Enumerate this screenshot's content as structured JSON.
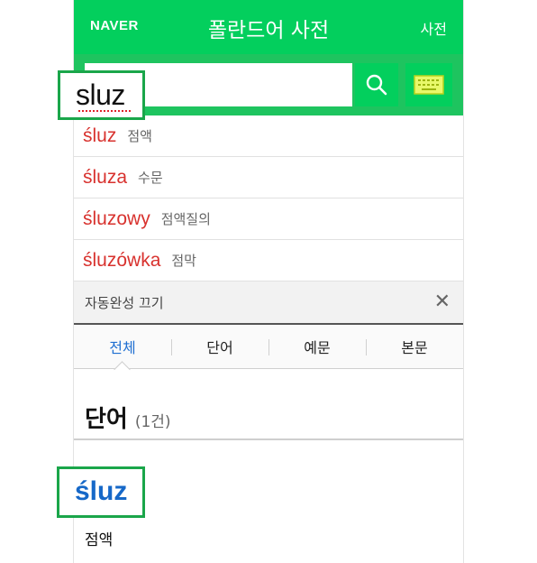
{
  "header": {
    "logo": "NAVER",
    "title": "폴란드어 사전",
    "link": "사전"
  },
  "search": {
    "query": "sluz",
    "search_icon": "search-icon",
    "keyboard_icon": "keyboard-icon"
  },
  "suggestions": [
    {
      "word": "śluz",
      "meaning": "점액"
    },
    {
      "word": "śluza",
      "meaning": "수문"
    },
    {
      "word": "śluzowy",
      "meaning": "점액질의"
    },
    {
      "word": "śluzówka",
      "meaning": "점막"
    }
  ],
  "autocomplete": {
    "label": "자동완성 끄기",
    "close_icon": "close-icon"
  },
  "tabs": [
    {
      "label": "전체",
      "active": true
    },
    {
      "label": "단어",
      "active": false
    },
    {
      "label": "예문",
      "active": false
    },
    {
      "label": "본문",
      "active": false
    }
  ],
  "section": {
    "title": "단어",
    "count": "(1건)"
  },
  "entry": {
    "word": "śluz",
    "meaning": "점액"
  },
  "colors": {
    "brand_green": "#03cf5d",
    "suggestion_red": "#d8322e",
    "entry_blue": "#1668c8",
    "active_tab_blue": "#1f6fd1"
  }
}
